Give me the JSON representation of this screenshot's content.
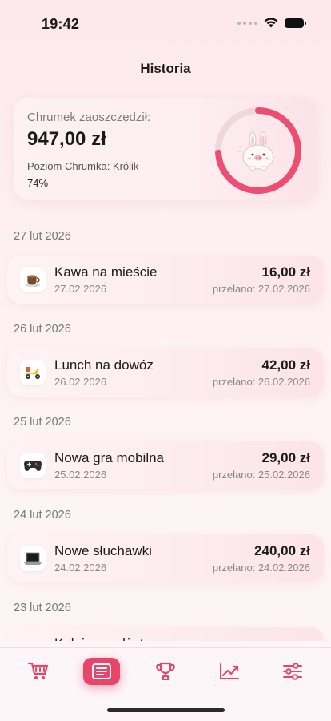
{
  "status_bar": {
    "time": "19:42"
  },
  "page": {
    "title": "Historia"
  },
  "summary": {
    "label": "Chrumek zaoszczędził:",
    "amount": "947,00 zł",
    "level": "Poziom Chrumka: Królik",
    "percent": "74%",
    "progress": 0.74,
    "avatar_icon": "bunny-pig-icon"
  },
  "groups": [
    {
      "date_header": "27 lut 2026",
      "tx": {
        "icon": "coffee-icon",
        "glyph": "☕",
        "title": "Kawa na mieście",
        "date": "27.02.2026",
        "amount": "16,00 zł",
        "transferred": "przelano: 27.02.2026"
      }
    },
    {
      "date_header": "26 lut 2026",
      "tx": {
        "icon": "scooter-icon",
        "glyph": "🛵",
        "title": "Lunch na dowóz",
        "date": "26.02.2026",
        "amount": "42,00 zł",
        "transferred": "przelano: 26.02.2026"
      }
    },
    {
      "date_header": "25 lut 2026",
      "tx": {
        "icon": "gamepad-icon",
        "glyph": "🎮",
        "title": "Nowa gra mobilna",
        "date": "25.02.2026",
        "amount": "29,00 zł",
        "transferred": "przelano: 25.02.2026"
      }
    },
    {
      "date_header": "24 lut 2026",
      "tx": {
        "icon": "laptop-icon",
        "glyph": "💻",
        "title": "Nowe słuchawki",
        "date": "24.02.2026",
        "amount": "240,00 zł",
        "transferred": "przelano: 24.02.2026"
      }
    },
    {
      "date_header": "23 lut 2026",
      "tx": {
        "icon": "gadget-icon",
        "glyph": "",
        "title": "Kolejny gadżet",
        "date": "",
        "amount": "",
        "transferred": ""
      }
    }
  ],
  "tab_bar": {
    "tabs": [
      {
        "name": "cart-icon",
        "active": false
      },
      {
        "name": "history-list-icon",
        "active": true
      },
      {
        "name": "trophy-icon",
        "active": false
      },
      {
        "name": "chart-trend-icon",
        "active": false
      },
      {
        "name": "settings-sliders-icon",
        "active": false
      }
    ]
  },
  "colors": {
    "accent": "#e8456b",
    "ring_track": "#f0d7dc"
  }
}
